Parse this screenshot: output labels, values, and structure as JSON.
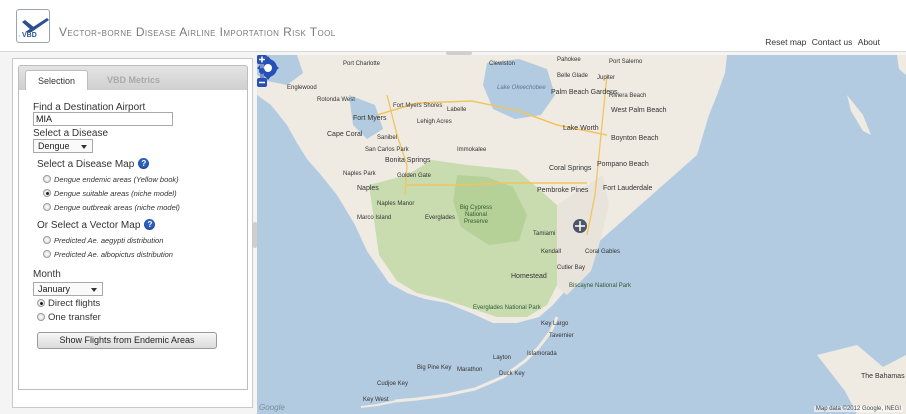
{
  "app": {
    "title": "Vector-borne Disease Airline Importation Risk Tool",
    "logo_text": "VBD"
  },
  "nav": {
    "reset_map": "Reset map",
    "contact": "Contact us",
    "about": "About"
  },
  "tabs": [
    {
      "label": "Selection",
      "active": true
    },
    {
      "label": "VBD Metrics",
      "active": false
    }
  ],
  "form": {
    "airport_label": "Find a Destination Airport",
    "airport_value": "MIA",
    "disease_label": "Select a Disease",
    "disease_value": "Dengue",
    "disease_map_label": "Select a Disease Map",
    "disease_maps": [
      {
        "label": "Dengue endemic areas (Yellow book)",
        "selected": false
      },
      {
        "label": "Dengue suitable areas (niche model)",
        "selected": true
      },
      {
        "label": "Dengue outbreak areas (niche model)",
        "selected": false
      }
    ],
    "vector_map_label": "Or Select a Vector Map",
    "vector_maps": [
      {
        "label": "Predicted Ae. aegypti distribution",
        "selected": false
      },
      {
        "label": "Predicted Ae. albopictus distribution",
        "selected": false
      }
    ],
    "month_label": "Month",
    "month_value": "January",
    "flight_options": [
      {
        "label": "Direct flights",
        "selected": true
      },
      {
        "label": "One transfer",
        "selected": false
      }
    ],
    "show_button": "Show Flights from Endemic Areas"
  },
  "map": {
    "attribution": "Map data ©2012 Google, INEGI",
    "logo": "Google",
    "places": {
      "port_charlotte": "Port Charlotte",
      "englewood": "Englewood",
      "rotonda": "Rotonda West",
      "fort_myers_shores": "Fort Myers Shores",
      "labelle": "Labelle",
      "fort_myers": "Fort Myers",
      "lehigh": "Lehigh Acres",
      "cape_coral": "Cape Coral",
      "sanibel": "Sanibel",
      "immokalee": "Immokalee",
      "san_carlos": "San Carlos Park",
      "bonita": "Bonita Springs",
      "naples_park": "Naples Park",
      "golden_gate": "Golden Gate",
      "naples": "Naples",
      "naples_manor": "Naples Manor",
      "marco": "Marco Island",
      "everglades": "Everglades",
      "big_cypress": "Big Cypress National Preserve",
      "clewiston": "Clewiston",
      "belle_glade": "Belle Glade",
      "pahokee": "Pahokee",
      "port_salerno": "Port Salerno",
      "jupiter": "Jupiter",
      "palm_beach_gardens": "Palm Beach Gardens",
      "riviera": "Riviera Beach",
      "west_palm": "West Palm Beach",
      "lake_worth": "Lake Worth",
      "boynton": "Boynton Beach",
      "coral_springs": "Coral Springs",
      "pompano": "Pompano Beach",
      "pembroke": "Pembroke Pines",
      "fort_lauderdale": "Fort Lauderdale",
      "tamiami": "Tamiami",
      "kendall": "Kendall",
      "coral_gables": "Coral Gables",
      "cutler_bay": "Cutler Bay",
      "homestead": "Homestead",
      "biscayne": "Biscayne National Park",
      "everglades_np": "Everglades National Park",
      "key_largo": "Key Largo",
      "tavernier": "Tavernier",
      "islamorada": "Islamorada",
      "layton": "Layton",
      "big_pine": "Big Pine Key",
      "marathon": "Marathon",
      "duck_key": "Duck Key",
      "cudjoe": "Cudjoe Key",
      "key_west": "Key West",
      "the_bahamas": "The Bahamas",
      "lake_okee": "Lake Okeechobee"
    }
  }
}
